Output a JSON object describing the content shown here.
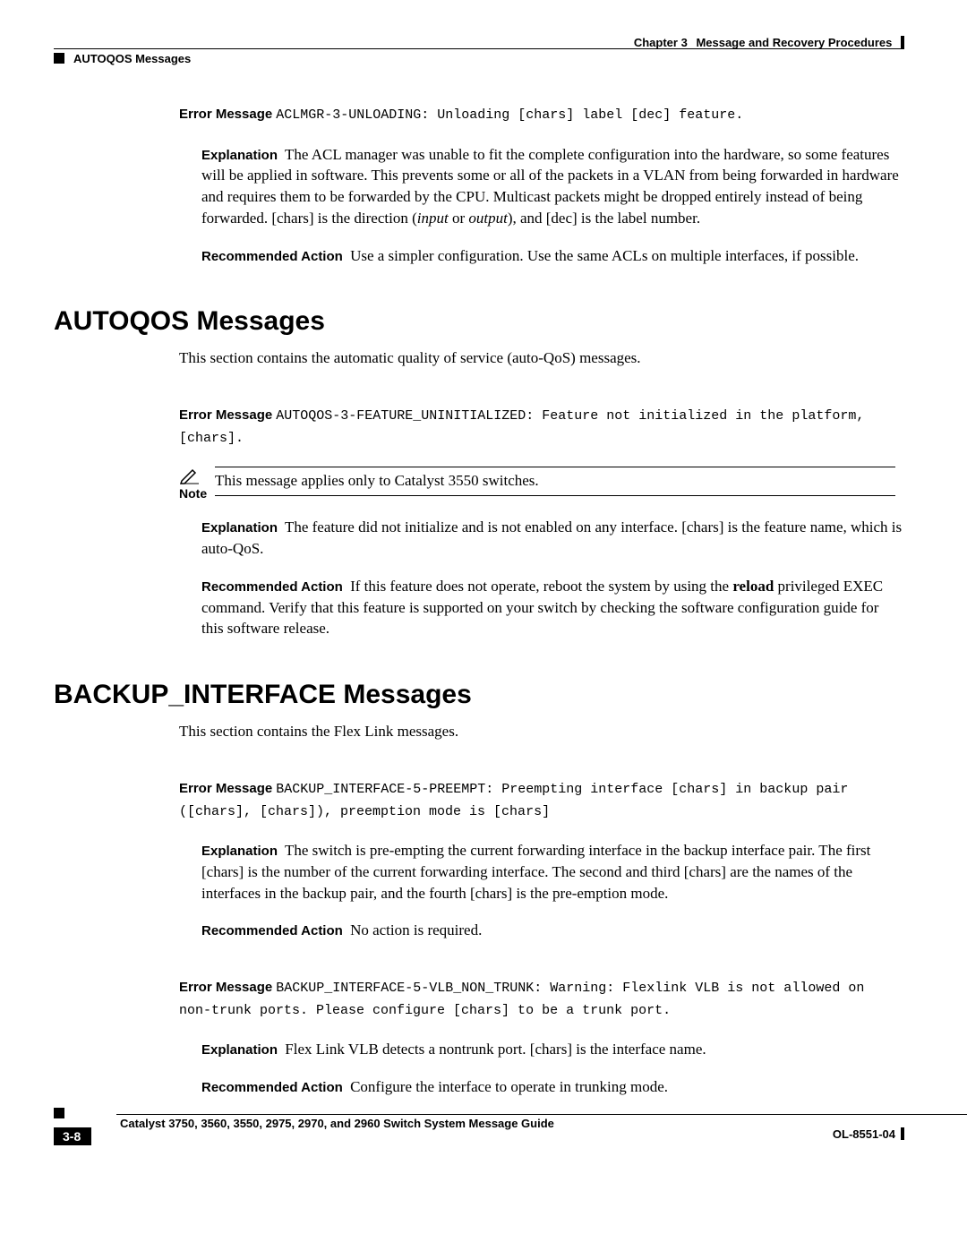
{
  "header": {
    "chapter_label": "Chapter 3",
    "chapter_title": "Message and Recovery Procedures",
    "section_running": "AUTOQOS Messages"
  },
  "msg1": {
    "label": "Error Message",
    "code": "ACLMGR-3-UNLOADING: Unloading [chars] label [dec] feature.",
    "explain_label": "Explanation",
    "explain_text_a": "The ACL manager was unable to fit the complete configuration into the hardware, so some features will be applied in software. This prevents some or all of the packets in a VLAN from being forwarded in hardware and requires them to be forwarded by the CPU. Multicast packets might be dropped entirely instead of being forwarded. [chars] is the direction (",
    "explain_italic_1": "input",
    "explain_text_b": " or ",
    "explain_italic_2": "output",
    "explain_text_c": "), and [dec] is the label number.",
    "rec_label": "Recommended Action",
    "rec_text": "Use a simpler configuration. Use the same ACLs on multiple interfaces, if possible."
  },
  "autoqos": {
    "heading": "AUTOQOS Messages",
    "intro": "This section contains the automatic quality of service (auto-QoS) messages.",
    "msg": {
      "label": "Error Message",
      "code": "AUTOQOS-3-FEATURE_UNINITIALIZED: Feature not initialized in the platform, [chars].",
      "note_label": "Note",
      "note_text": "This message applies only to Catalyst 3550 switches.",
      "explain_label": "Explanation",
      "explain_text": "The feature did not initialize and is not enabled on any interface. [chars] is the feature name, which is auto-QoS.",
      "rec_label": "Recommended Action",
      "rec_text_a": "If this feature does not operate, reboot the system by using the ",
      "rec_bold": "reload",
      "rec_text_b": " privileged EXEC command. Verify that this feature is supported on your switch by checking the software configuration guide for this software release."
    }
  },
  "backup": {
    "heading": "BACKUP_INTERFACE Messages",
    "intro": "This section contains the Flex Link messages.",
    "msg1": {
      "label": "Error Message",
      "code": "BACKUP_INTERFACE-5-PREEMPT: Preempting interface [chars] in backup pair ([chars], [chars]), preemption mode is [chars]",
      "explain_label": "Explanation",
      "explain_text": "The switch is pre-empting the current forwarding interface in the backup interface pair. The first [chars] is the number of the current forwarding interface. The second and third [chars] are the names of the interfaces in the backup pair, and the fourth [chars] is the pre-emption mode.",
      "rec_label": "Recommended Action",
      "rec_text": "No action is required."
    },
    "msg2": {
      "label": "Error Message",
      "code": "BACKUP_INTERFACE-5-VLB_NON_TRUNK: Warning:  Flexlink VLB is not allowed on non-trunk ports.  Please configure [chars] to be a trunk port.",
      "explain_label": "Explanation",
      "explain_text": "Flex Link VLB detects a nontrunk port. [chars] is the interface name.",
      "rec_label": "Recommended Action",
      "rec_text": "Configure the interface to operate in trunking mode."
    }
  },
  "footer": {
    "book_title": "Catalyst 3750, 3560, 3550, 2975, 2970, and 2960 Switch System Message Guide",
    "page": "3-8",
    "doc_id": "OL-8551-04"
  }
}
